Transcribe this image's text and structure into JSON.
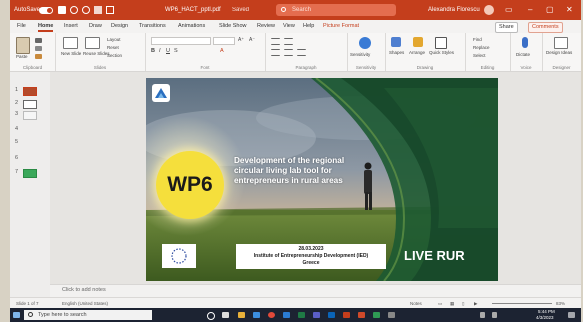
{
  "titlebar": {
    "autosave": "AutoSave",
    "filename": "WP6_HACT_pptl.pdf",
    "app": "Saved",
    "search_placeholder": "Search",
    "user": "Alexandra Florescu"
  },
  "tabs": [
    "File",
    "Home",
    "Insert",
    "Draw",
    "Design",
    "Transitions",
    "Animations",
    "Slide Show",
    "Review",
    "View",
    "Help",
    "Picture Format"
  ],
  "tab_buttons": {
    "share": "Share",
    "comments": "Comments"
  },
  "ribbon": {
    "groups": [
      {
        "label": "Clipboard",
        "items": [
          "Paste"
        ]
      },
      {
        "label": "Slides",
        "items": [
          "New Slide",
          "Reuse Slides",
          "Layout",
          "Reset",
          "Section"
        ]
      },
      {
        "label": "Font",
        "items": []
      },
      {
        "label": "Paragraph",
        "items": []
      },
      {
        "label": "Sensitivity",
        "items": [
          "Sensitivity"
        ]
      },
      {
        "label": "Drawing",
        "items": [
          "Shapes",
          "Arrange",
          "Quick Styles"
        ]
      },
      {
        "label": "Editing",
        "items": [
          "Find",
          "Replace",
          "Select"
        ]
      },
      {
        "label": "Voice",
        "items": [
          "Dictate"
        ]
      },
      {
        "label": "Designer",
        "items": [
          "Design Ideas"
        ]
      }
    ]
  },
  "thumbnails": [
    "1",
    "2",
    "3",
    "4",
    "5",
    "6",
    "7"
  ],
  "slide": {
    "badge": "WP6",
    "headline": "Development of the regional circular living lab tool for entrepreneurs in rural areas",
    "date": "28.03.2023",
    "institution": "Institute of Entrepreneurship Development (IED)",
    "place": "Greece",
    "logo_text": "LIVE RUR"
  },
  "notes_placeholder": "Click to add notes",
  "statusbar": {
    "slide_count": "Slide 1 of 7",
    "language": "English (United States)",
    "notes": "Notes",
    "zoom": "83%"
  },
  "taskbar": {
    "search_placeholder": "Type here to search",
    "time": "5:44 PM",
    "date": "4/3/2023"
  },
  "colors": {
    "accent": "#c43e1c",
    "badge": "#f5df3c",
    "slide_green": "#1d5a32"
  }
}
